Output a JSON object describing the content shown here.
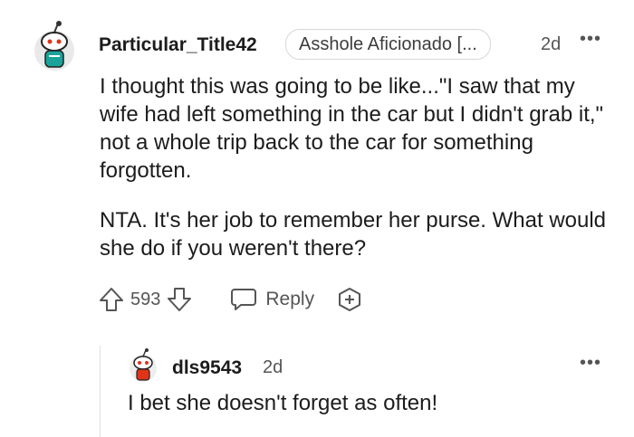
{
  "comment": {
    "username": "Particular_Title42",
    "flair": "Asshole Aficionado [...",
    "time": "2d",
    "more": "•••",
    "paragraphs": [
      "I thought this was going to be like...\"I saw that my wife had left something in the car but I didn't grab it,\" not a whole trip back to the car for something forgotten.",
      "NTA. It's her job to remember her purse. What would she do if you weren't there?"
    ],
    "votes": "593",
    "reply_label": "Reply"
  },
  "reply": {
    "username": "dls9543",
    "time": "2d",
    "more": "•••",
    "text": "I bet she doesn't forget as often!"
  },
  "icons": [
    "snoo-avatar-icon",
    "upvote-icon",
    "downvote-icon",
    "reply-bubble-icon",
    "award-plus-icon",
    "more-options-icon"
  ],
  "colors": {
    "text": "#1c1c1c",
    "meta": "#555555",
    "flair_border": "#d7d7d7",
    "avatar_accent": "#1aa39a"
  }
}
